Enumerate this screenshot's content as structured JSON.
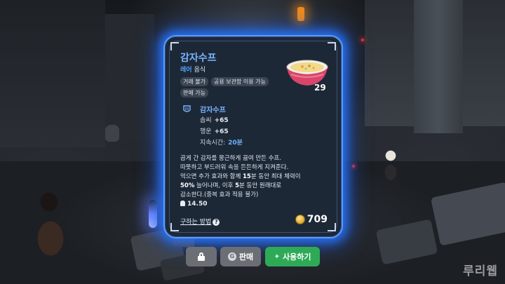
{
  "item": {
    "name": "감자수프",
    "rarity": "레어",
    "category": "음식",
    "tags": [
      "거래 불가",
      "공용 보관함 이용 가능",
      "판매 가능"
    ],
    "count": "29"
  },
  "effect": {
    "title": "감자수프",
    "stats": [
      {
        "label": "솜씨",
        "value": "+65"
      },
      {
        "label": "행운",
        "value": "+65"
      },
      {
        "label": "지속시간:",
        "value": "20분"
      }
    ]
  },
  "description": {
    "line1": "곱게 간 감자를 뭉근하게 끓여 만든 수프.",
    "line2": "따뜻하고 부드러워 속을 든든하게 지켜준다.",
    "line3_a": "먹으면 추가 효과와 함께 ",
    "line3_b": "15",
    "line3_c": "분 동안 최대 체력이",
    "line4_a": "50%",
    "line4_b": " 늘어나며, 이후 ",
    "line4_c": "5",
    "line4_d": "분 동안 원래대로",
    "line5": "감소한다.(중복 효과 적용 불가)"
  },
  "weight": "14.50",
  "how_to_get": "구하는 방법",
  "help_glyph": "?",
  "price": "709",
  "buttons": {
    "sell": "판매",
    "use": "사용하기"
  },
  "watermark": "루리웹",
  "icons": {
    "effect": "shield-food-icon",
    "coin": "gold-coin-icon",
    "lock": "lock-icon",
    "sell": "sell-coin-icon",
    "use": "sparkle-icon"
  },
  "colors": {
    "card_glow": "#2f7dff",
    "rarity": "#4ea1ff",
    "use_button": "#2eaa57"
  }
}
